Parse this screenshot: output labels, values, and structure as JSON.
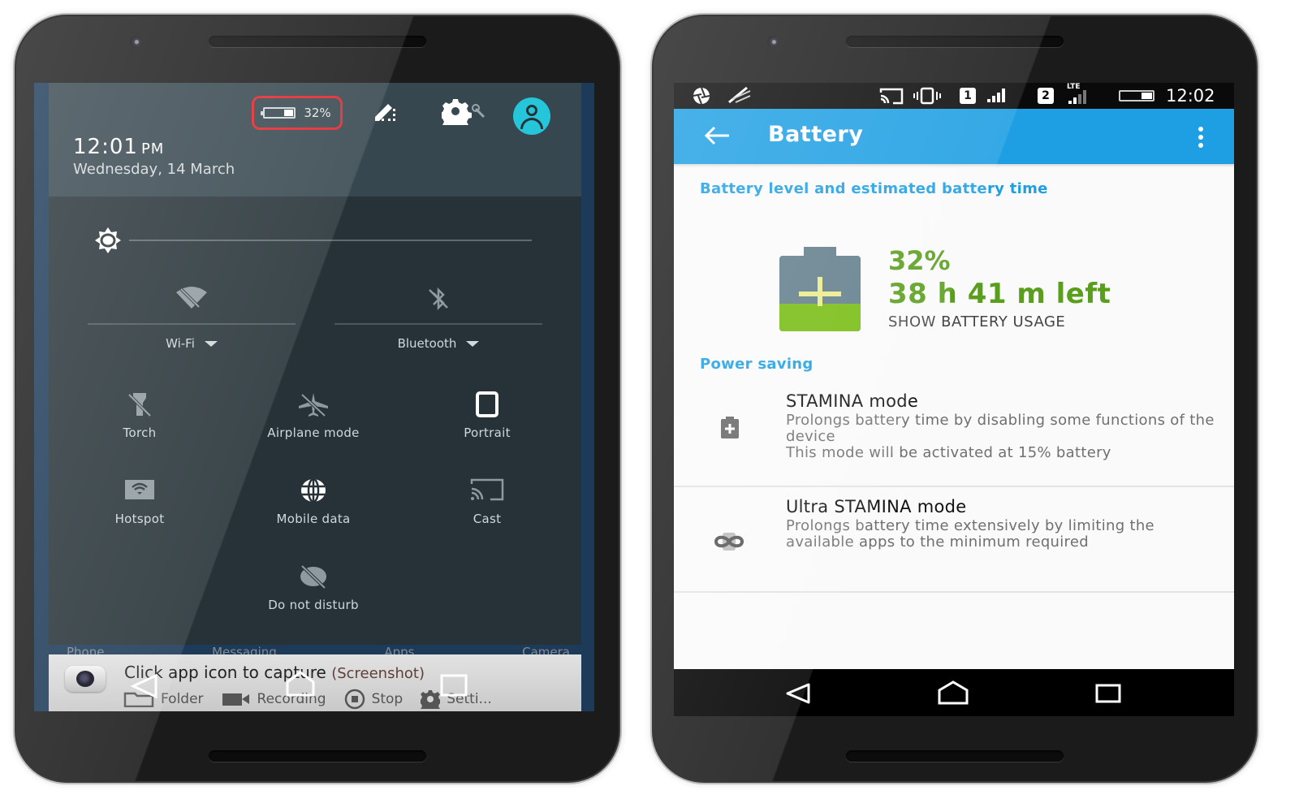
{
  "left_phone": {
    "header": {
      "battery_percent_label": "32%",
      "battery_level": 0.32,
      "time": "12:01",
      "time_suffix": "PM",
      "date": "Wednesday, 14 March",
      "highlight_color": "#e1252c",
      "avatar_color": "#26c6da"
    },
    "brightness_level": 0.0,
    "big_tiles": [
      {
        "label": "Wi-Fi",
        "icon": "wifi-off-icon"
      },
      {
        "label": "Bluetooth",
        "icon": "bluetooth-off-icon"
      }
    ],
    "tiles": [
      {
        "label": "Torch",
        "icon": "flashlight-off-icon"
      },
      {
        "label": "Airplane mode",
        "icon": "airplane-off-icon"
      },
      {
        "label": "Portrait",
        "icon": "portrait-icon"
      },
      {
        "label": "Hotspot",
        "icon": "hotspot-icon"
      },
      {
        "label": "Mobile data",
        "icon": "globe-icon"
      },
      {
        "label": "Cast",
        "icon": "cast-icon"
      },
      {
        "label": "Do not disturb",
        "icon": "dnd-off-icon"
      }
    ],
    "dock_labels": [
      "Phone",
      "Messaging",
      "Apps",
      "Camera"
    ],
    "notification": {
      "title": "Click app icon to capture",
      "subtitle": "(Screenshot)",
      "actions": [
        {
          "label": "Folder",
          "icon": "folder-icon"
        },
        {
          "label": "Recording",
          "icon": "video-camera-icon"
        },
        {
          "label": "Stop",
          "icon": "stop-icon"
        },
        {
          "label": "Setti...",
          "icon": "gear-icon"
        }
      ]
    }
  },
  "right_phone": {
    "status_bar": {
      "sim1": "1",
      "sim2": "2",
      "network_type": "LTE",
      "time": "12:02"
    },
    "app_bar": {
      "title": "Battery",
      "color": "#1e9fe3"
    },
    "battery_section": {
      "heading": "Battery level and estimated battery time",
      "percent_label": "32%",
      "level": 0.32,
      "time_left": "38 h 41 m left",
      "usage_link": "SHOW BATTERY USAGE",
      "accent_color": "#5a9e1d"
    },
    "power_saving": {
      "heading": "Power saving",
      "modes": [
        {
          "title": "STAMINA mode",
          "description": "Prolongs battery time by disabling some functions of the device",
          "note": "This mode will be activated at 15% battery",
          "icon": "battery-plus-icon"
        },
        {
          "title": "Ultra STAMINA mode",
          "description": "Prolongs battery time extensively by limiting the available apps to the minimum required",
          "icon": "infinity-icon"
        }
      ]
    }
  }
}
